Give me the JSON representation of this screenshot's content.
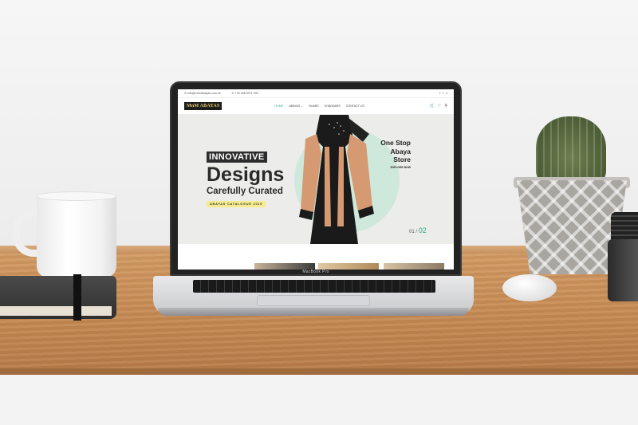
{
  "device": {
    "label": "MacBook Pro"
  },
  "site": {
    "topbar": {
      "email": "info@mnmabayas.com.uk",
      "phone": "+92 306 8071 005",
      "social": [
        "f",
        "t",
        "v"
      ]
    },
    "logo": "MnM ABAYAS",
    "menu": [
      "HOME",
      "ABAYAS ⌄",
      "HIJABS",
      "CHADDARS",
      "CONTACT US"
    ],
    "nav_icons": {
      "cart": "cart-icon",
      "wishlist": "heart-icon",
      "search": "search-icon"
    },
    "hero": {
      "badge": "INNOVATIVE",
      "title": "Designs",
      "subtitle": "Carefully Curated",
      "cta": "ABAYAS CATALOGUE 2019",
      "tagline_1": "One Stop",
      "tagline_2": "Abaya",
      "tagline_3": "Store",
      "tag_link": "EXPLORE NOW",
      "slide_prev": "01",
      "slide_sep": "/",
      "slide_current": "02"
    },
    "colors": {
      "accent": "#2aa88a",
      "circle": "#cfe8dc",
      "logo_text": "#e7c96b"
    }
  }
}
